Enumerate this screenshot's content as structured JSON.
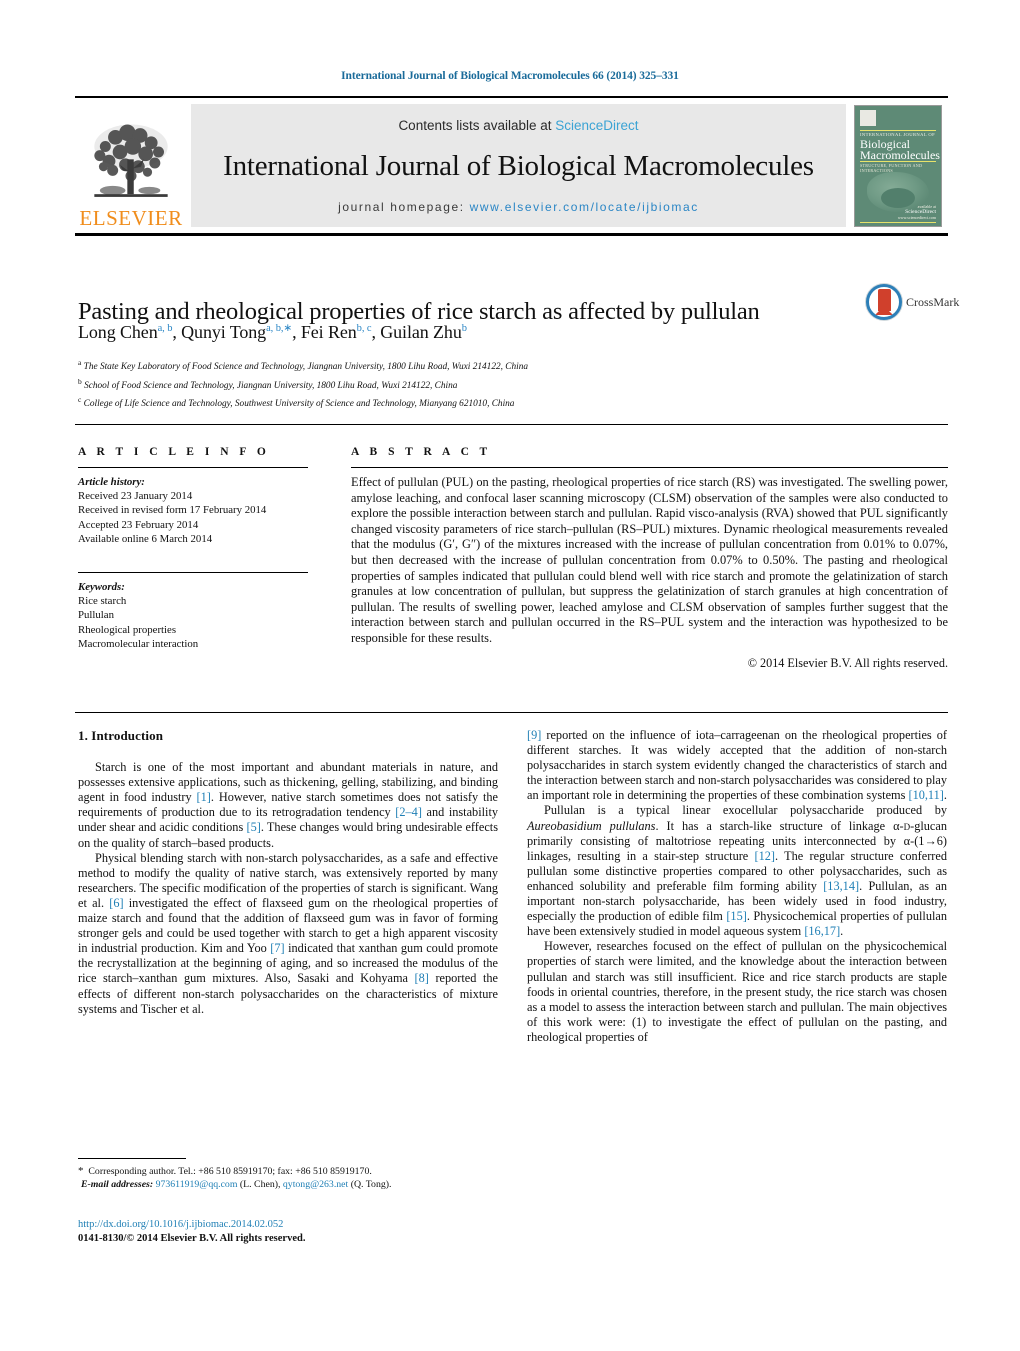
{
  "running_head": "International Journal of Biological Macromolecules 66 (2014) 325–331",
  "masthead": {
    "publisher_logo_text": "ELSEVIER",
    "contents_prefix": "Contents lists available at ",
    "contents_link": "ScienceDirect",
    "journal_title": "International Journal of Biological Macromolecules",
    "homepage_prefix": "journal homepage: ",
    "homepage_url": "www.elsevier.com/locate/ijbiomac",
    "cover": {
      "kicker": "INTERNATIONAL JOURNAL OF",
      "line1": "Biological",
      "line2": "Macromolecules",
      "subtitle": "STRUCTURE, FUNCTION AND INTERACTIONS",
      "footer_available": "available at",
      "footer_brand": "ScienceDirect",
      "footer_url": "www.sciencedirect.com"
    }
  },
  "article": {
    "title": "Pasting and rheological properties of rice starch as affected by pullulan",
    "crossmark_label": "CrossMark",
    "authors_html": "Long Chen<sup>a, b</sup>, Qunyi Tong<sup>a, b,∗</sup>, Fei Ren<sup>b, c</sup>, Guilan Zhu<sup>b</sup>",
    "affiliations": [
      {
        "marker": "a",
        "text": "The State Key Laboratory of Food Science and Technology, Jiangnan University, 1800 Lihu Road, Wuxi 214122, China"
      },
      {
        "marker": "b",
        "text": "School of Food Science and Technology, Jiangnan University, 1800 Lihu Road, Wuxi 214122, China"
      },
      {
        "marker": "c",
        "text": "College of Life Science and Technology, Southwest University of Science and Technology, Mianyang 621010, China"
      }
    ]
  },
  "article_info": {
    "heading": "A R T I C L E   I N F O",
    "history_label": "Article history:",
    "history": [
      "Received 23 January 2014",
      "Received in revised form 17 February 2014",
      "Accepted 23 February 2014",
      "Available online 6 March 2014"
    ],
    "keywords_label": "Keywords:",
    "keywords": [
      "Rice starch",
      "Pullulan",
      "Rheological properties",
      "Macromolecular interaction"
    ]
  },
  "abstract": {
    "heading": "A B S T R A C T",
    "text": "Effect of pullulan (PUL) on the pasting, rheological properties of rice starch (RS) was investigated. The swelling power, amylose leaching, and confocal laser scanning microscopy (CLSM) observation of the samples were also conducted to explore the possible interaction between starch and pullulan. Rapid visco-analysis (RVA) showed that PUL significantly changed viscosity parameters of rice starch–pullulan (RS–PUL) mixtures. Dynamic rheological measurements revealed that the modulus (G′, G″) of the mixtures increased with the increase of pullulan concentration from 0.01% to 0.07%, but then decreased with the increase of pullulan concentration from 0.07% to 0.50%. The pasting and rheological properties of samples indicated that pullulan could blend well with rice starch and promote the gelatinization of starch granules at low concentration of pullulan, but suppress the gelatinization of starch granules at high concentration of pullulan. The results of swelling power, leached amylose and CLSM observation of samples further suggest that the interaction between starch and pullulan occurred in the RS–PUL system and the interaction was hypothesized to be responsible for these results.",
    "copyright": "© 2014 Elsevier B.V. All rights reserved."
  },
  "body": {
    "section_heading": "1.  Introduction",
    "left_paragraphs_html": [
      "Starch is one of the most important and abundant materials in nature, and possesses extensive applications, such as thickening, gelling, stabilizing, and binding agent in food industry <span class=\"ref\">[1]</span>. However, native starch sometimes does not satisfy the requirements of production due to its retrogradation tendency <span class=\"ref\">[2–4]</span> and instability under shear and acidic conditions <span class=\"ref\">[5]</span>. These changes would bring undesirable effects on the quality of starch–based products.",
      "Physical blending starch with non-starch polysaccharides, as a safe and effective method to modify the quality of native starch, was extensively reported by many researchers. The specific modification of the properties of starch is significant. Wang et al. <span class=\"ref\">[6]</span> investigated the effect of flaxseed gum on the rheological properties of maize starch and found that the addition of flaxseed gum was in favor of forming stronger gels and could be used together with starch to get a high apparent viscosity in industrial production. Kim and Yoo <span class=\"ref\">[7]</span> indicated that xanthan gum could promote the recrystallization at the beginning of aging, and so increased the modulus of the rice starch–xanthan gum mixtures. Also, Sasaki and Kohyama <span class=\"ref\">[8]</span> reported the effects of different non-starch polysaccharides on the characteristics of mixture systems and Tischer et al."
    ],
    "right_paragraphs_html": [
      "<span class=\"ref\">[9]</span> reported on the influence of iota–carrageenan on the rheological properties of different starches. It was widely accepted that the addition of non-starch polysaccharides in starch system evidently changed the characteristics of starch and the interaction between starch and non-starch polysaccharides was considered to play an important role in determining the properties of these combination systems <span class=\"ref\">[10,11]</span>.",
      "Pullulan is a typical linear exocellular polysaccharide produced by <i>Aureobasidium pullulans</i>. It has a starch-like structure of linkage α-<span style=\"font-variant:small-caps\">d</span>-glucan primarily consisting of maltotriose repeating units interconnected by α-(1→6) linkages, resulting in a stair-step structure <span class=\"ref\">[12]</span>. The regular structure conferred pullulan some distinctive properties compared to other polysaccharides, such as enhanced solubility and preferable film forming ability <span class=\"ref\">[13,14]</span>. Pullulan, as an important non-starch polysaccharide, has been widely used in food industry, especially the production of edible film <span class=\"ref\">[15]</span>. Physicochemical properties of pullulan have been extensively studied in model aqueous system <span class=\"ref\">[16,17]</span>.",
      "However, researches focused on the effect of pullulan on the physicochemical properties of starch were limited, and the knowledge about the interaction between pullulan and starch was still insufficient. Rice and rice starch products are staple foods in oriental countries, therefore, in the present study, the rice starch was chosen as a model to assess the interaction between starch and pullulan. The main objectives of this work were: (1) to investigate the effect of pullulan on the pasting, and rheological properties of"
    ]
  },
  "footer": {
    "corresponding_html": "<span style=\"font-size:11px\">*</span>&nbsp; Corresponding author. Tel.: +86 510 85919170; fax: +86 510 85919170.",
    "email_label": "E-mail addresses:",
    "email1": "973611919@qq.com",
    "email1_owner": "(L. Chen),",
    "email2": "qytong@263.net",
    "email2_owner": "(Q. Tong).",
    "doi_url": "http://dx.doi.org/10.1016/j.ijbiomac.2014.02.052",
    "issn_line": "0141-8130/© 2014 Elsevier B.V. All rights reserved."
  },
  "colors": {
    "link_blue": "#1f7fb5",
    "sciencedirect_blue": "#3ba3d4",
    "elsevier_orange": "#f08d1c",
    "crossmark_red": "#d0402c",
    "crossmark_blue": "#2d7fb8",
    "cover_green": "#5e8a76"
  }
}
